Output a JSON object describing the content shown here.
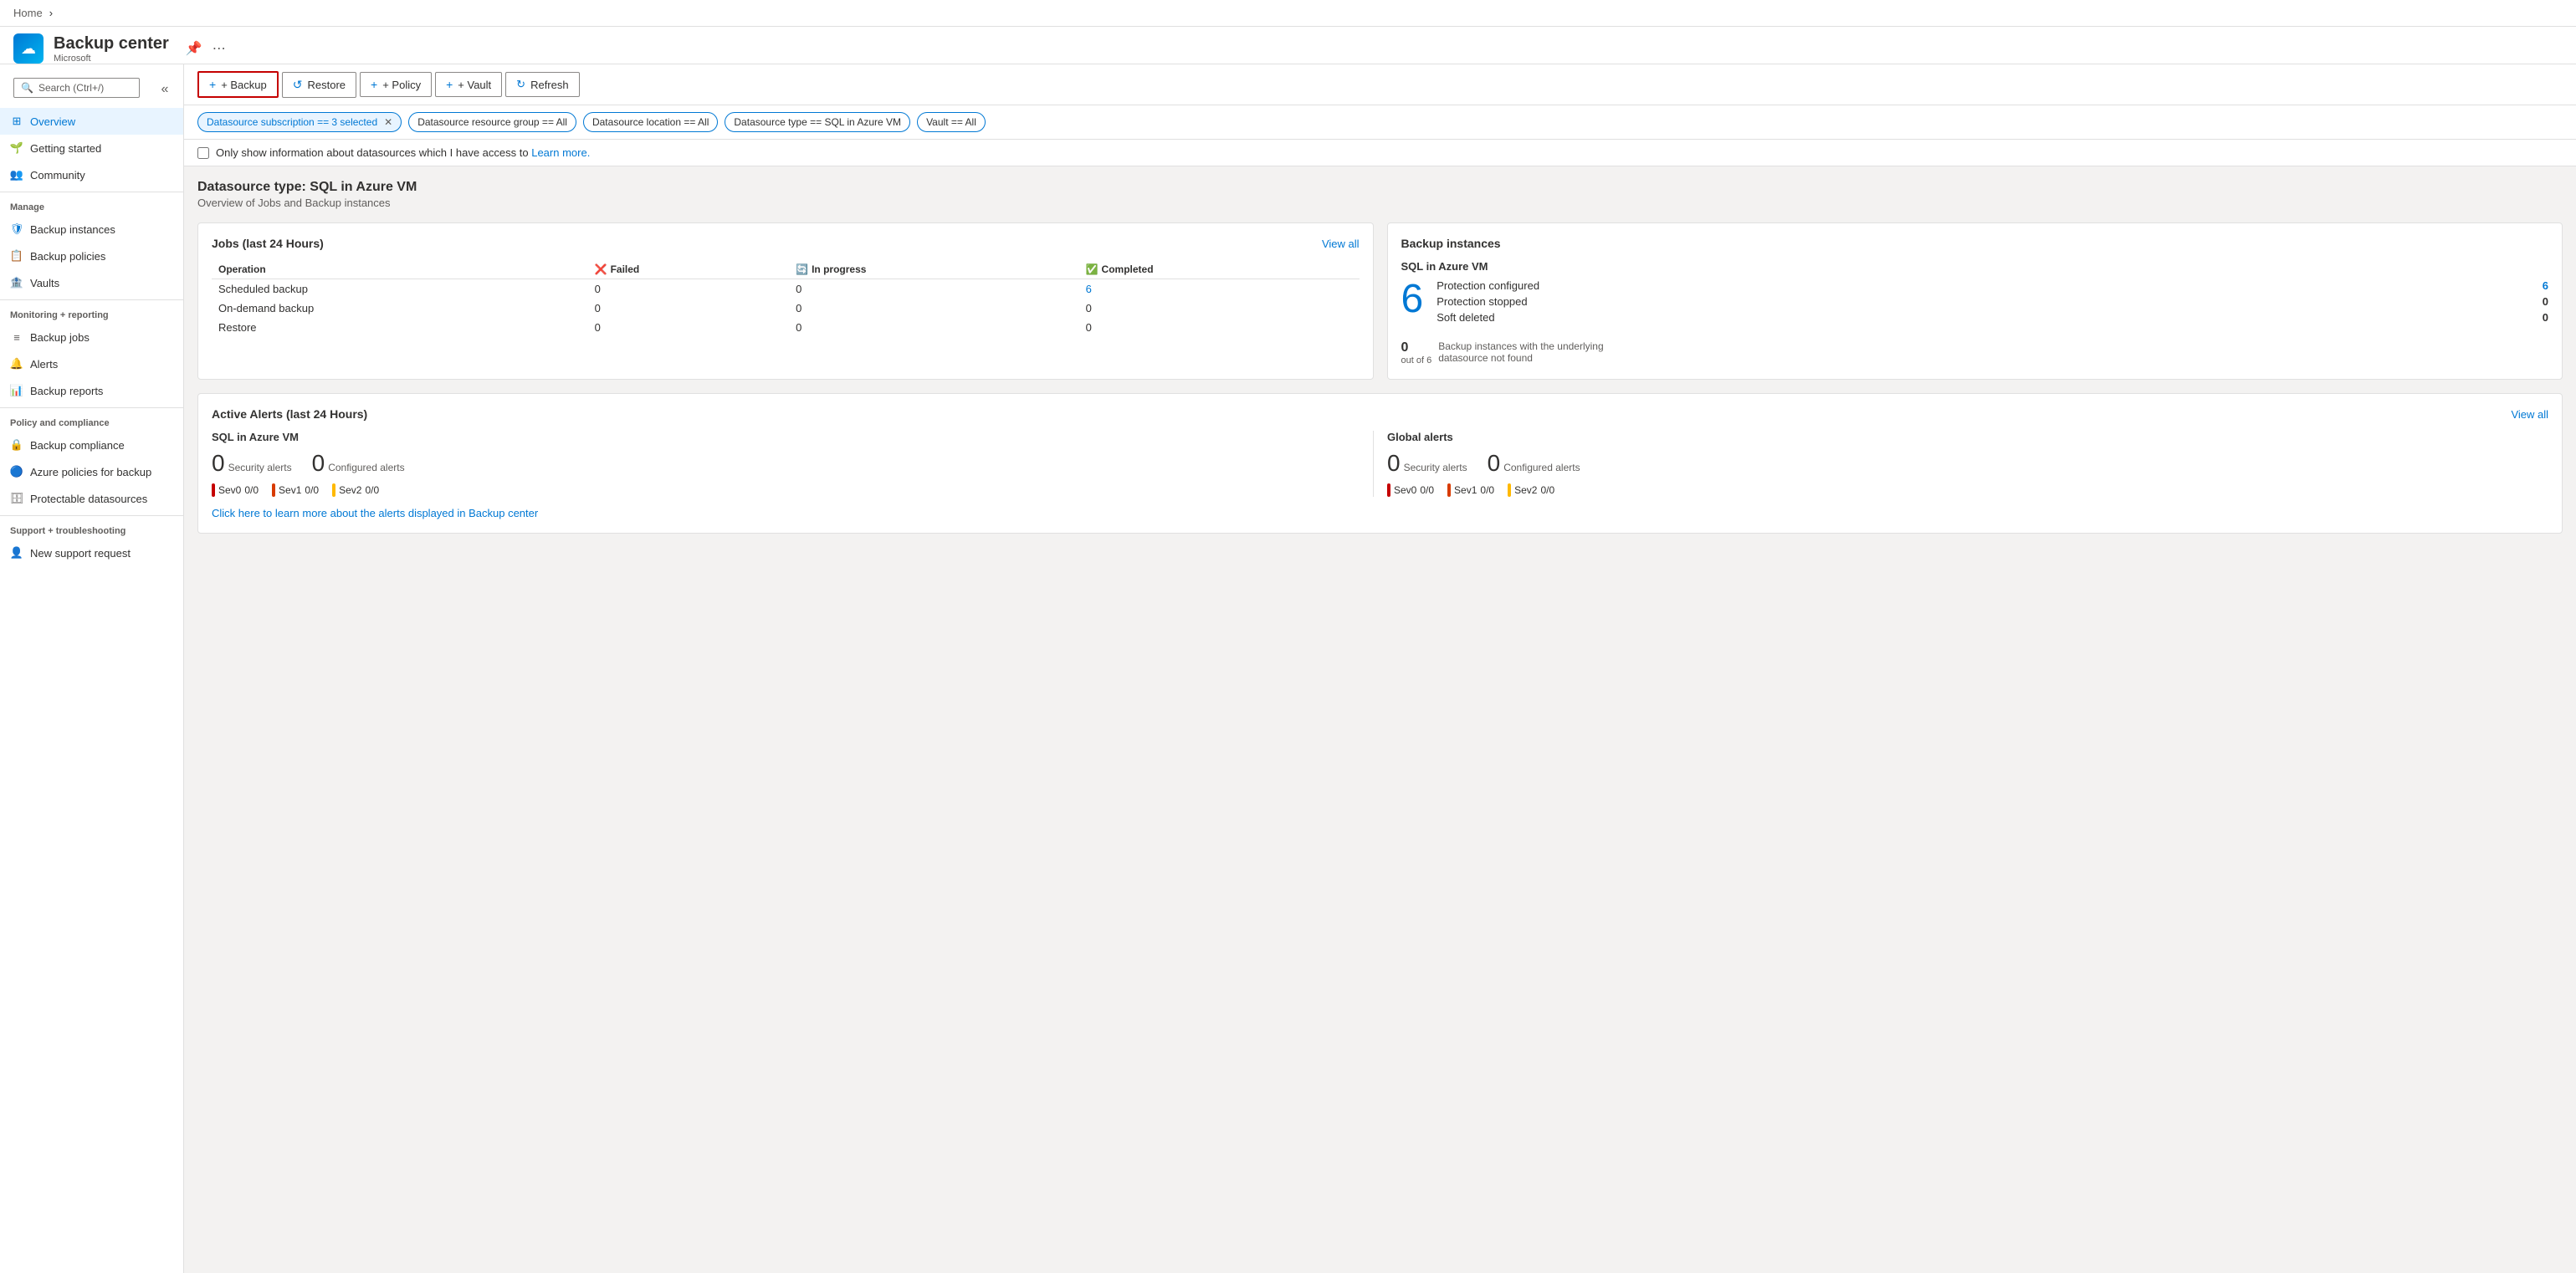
{
  "breadcrumb": {
    "home": "Home",
    "chevron": "›"
  },
  "app": {
    "title": "Backup center",
    "subtitle": "Microsoft",
    "pin_icon": "📌",
    "more_icon": "..."
  },
  "toolbar": {
    "backup_label": "+ Backup",
    "restore_label": "Restore",
    "policy_label": "+ Policy",
    "vault_label": "+ Vault",
    "refresh_label": "Refresh"
  },
  "filters": [
    {
      "label": "Datasource subscription == 3 selected",
      "active": true
    },
    {
      "label": "Datasource resource group == All",
      "active": false
    },
    {
      "label": "Datasource location == All",
      "active": false
    },
    {
      "label": "Datasource type == SQL in Azure VM",
      "active": false
    },
    {
      "label": "Vault == All",
      "active": false
    }
  ],
  "info_bar": {
    "checkbox_label": "Only show information about datasources which I have access to",
    "learn_more": "Learn more."
  },
  "page": {
    "section_title": "Datasource type: SQL in Azure VM",
    "section_subtitle": "Overview of Jobs and Backup instances"
  },
  "jobs_card": {
    "title": "Jobs (last 24 Hours)",
    "view_all": "View all",
    "columns": [
      "Operation",
      "Failed",
      "In progress",
      "Completed"
    ],
    "failed_icon": "❌",
    "progress_icon": "🔄",
    "completed_icon": "✅",
    "rows": [
      {
        "operation": "Scheduled backup",
        "failed": "0",
        "in_progress": "0",
        "completed": "6"
      },
      {
        "operation": "On-demand backup",
        "failed": "0",
        "in_progress": "0",
        "completed": "0"
      },
      {
        "operation": "Restore",
        "failed": "0",
        "in_progress": "0",
        "completed": "0"
      }
    ]
  },
  "backup_instances_card": {
    "title": "Backup instances",
    "subtitle": "SQL in Azure VM",
    "big_number": "6",
    "rows": [
      {
        "label": "Protection configured",
        "value": "6",
        "is_link": true
      },
      {
        "label": "Protection stopped",
        "value": "0",
        "is_link": false
      },
      {
        "label": "Soft deleted",
        "value": "0",
        "is_link": false
      }
    ],
    "sub_num": "0",
    "sub_denom": "out of 6",
    "sub_text": "Backup instances with the underlying datasource not found"
  },
  "alerts_card": {
    "title": "Active Alerts (last 24 Hours)",
    "view_all": "View all",
    "sql_section": {
      "title": "SQL in Azure VM",
      "security_count": "0",
      "security_label": "Security alerts",
      "configured_count": "0",
      "configured_label": "Configured alerts",
      "severities": [
        {
          "label": "Sev0",
          "value": "0/0",
          "color": "sev-red"
        },
        {
          "label": "Sev1",
          "value": "0/0",
          "color": "sev-orange"
        },
        {
          "label": "Sev2",
          "value": "0/0",
          "color": "sev-yellow"
        }
      ]
    },
    "global_section": {
      "title": "Global alerts",
      "security_count": "0",
      "security_label": "Security alerts",
      "configured_count": "0",
      "configured_label": "Configured alerts",
      "severities": [
        {
          "label": "Sev0",
          "value": "0/0",
          "color": "sev-red"
        },
        {
          "label": "Sev1",
          "value": "0/0",
          "color": "sev-orange"
        },
        {
          "label": "Sev2",
          "value": "0/0",
          "color": "sev-yellow"
        }
      ]
    },
    "footer_link": "Click here to learn more about the alerts displayed in Backup center"
  },
  "sidebar": {
    "search_placeholder": "Search (Ctrl+/)",
    "items_top": [
      {
        "id": "overview",
        "label": "Overview",
        "icon": "⊞",
        "active": true
      },
      {
        "id": "getting-started",
        "label": "Getting started",
        "icon": "🌱"
      },
      {
        "id": "community",
        "label": "Community",
        "icon": "👥"
      }
    ],
    "manage_label": "Manage",
    "items_manage": [
      {
        "id": "backup-instances",
        "label": "Backup instances",
        "icon": "🛡"
      },
      {
        "id": "backup-policies",
        "label": "Backup policies",
        "icon": "📋"
      },
      {
        "id": "vaults",
        "label": "Vaults",
        "icon": "🏦"
      }
    ],
    "monitoring_label": "Monitoring + reporting",
    "items_monitoring": [
      {
        "id": "backup-jobs",
        "label": "Backup jobs",
        "icon": "≡"
      },
      {
        "id": "alerts",
        "label": "Alerts",
        "icon": "🔔"
      },
      {
        "id": "backup-reports",
        "label": "Backup reports",
        "icon": "📊"
      }
    ],
    "policy_label": "Policy and compliance",
    "items_policy": [
      {
        "id": "backup-compliance",
        "label": "Backup compliance",
        "icon": "🔒"
      },
      {
        "id": "azure-policies",
        "label": "Azure policies for backup",
        "icon": "🔵"
      },
      {
        "id": "protectable-datasources",
        "label": "Protectable datasources",
        "icon": "🗄"
      }
    ],
    "support_label": "Support + troubleshooting",
    "items_support": [
      {
        "id": "new-support",
        "label": "New support request",
        "icon": "👤"
      }
    ]
  }
}
